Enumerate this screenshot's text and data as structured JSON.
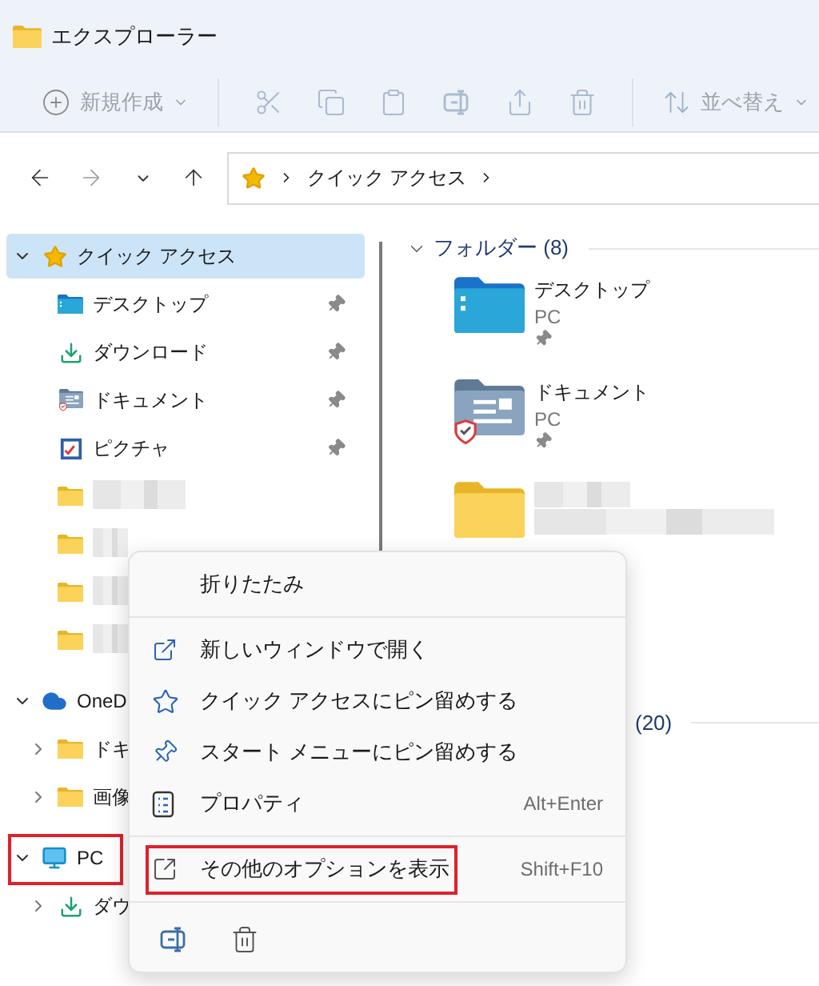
{
  "window": {
    "title": "エクスプローラー"
  },
  "toolbar": {
    "new_label": "新規作成",
    "sort_label": "並べ替え",
    "actions": [
      {
        "kind": "cut",
        "disabled": true
      },
      {
        "kind": "copy",
        "disabled": true
      },
      {
        "kind": "paste",
        "disabled": true
      },
      {
        "kind": "rename",
        "disabled": true
      },
      {
        "kind": "share",
        "disabled": true
      },
      {
        "kind": "delete",
        "disabled": true
      }
    ]
  },
  "navigation": {
    "back_disabled": false,
    "forward_disabled": true
  },
  "address_bar": {
    "path": [
      "クイック アクセス"
    ]
  },
  "sidebar": {
    "items": [
      {
        "label": "クイック アクセス",
        "kind": "star",
        "expanded": true,
        "selected": true,
        "children": [
          {
            "label": "デスクトップ",
            "kind": "desktop",
            "pinned": true,
            "selected": false
          },
          {
            "label": "ダウンロード",
            "kind": "download",
            "pinned": true,
            "selected": false
          },
          {
            "label": "ドキュメント",
            "kind": "documents",
            "pinned": true,
            "selected": false
          },
          {
            "label": "ピクチャ",
            "kind": "pictures",
            "pinned": true,
            "selected": false
          },
          {
            "kind": "folder",
            "blurred": true,
            "pinned": false,
            "selected": false
          },
          {
            "kind": "folder",
            "blurred": true,
            "pinned": false,
            "selected": false
          },
          {
            "kind": "folder",
            "blurred": true,
            "pinned": false,
            "selected": false
          },
          {
            "kind": "folder",
            "blurred": true,
            "pinned": false,
            "selected": false
          }
        ]
      },
      {
        "label": "OneD",
        "kind": "cloud",
        "expanded": true,
        "selected": false,
        "children": [
          {
            "label": "ドキ",
            "kind": "folder",
            "expanded": false,
            "selected": false
          },
          {
            "label": "画像",
            "kind": "folder",
            "expanded": false,
            "selected": false
          }
        ]
      },
      {
        "label": "PC",
        "kind": "pc",
        "expanded": true,
        "selected": false,
        "annotated": true,
        "children": [
          {
            "label": "ダウ",
            "kind": "download",
            "expanded": false,
            "selected": false
          }
        ]
      }
    ]
  },
  "main": {
    "sections": [
      {
        "title": "フォルダー (8)",
        "expanded": true,
        "items": [
          {
            "name": "デスクトップ",
            "location": "PC",
            "pinned": true,
            "kind": "desktop"
          },
          {
            "name": "ドキュメント",
            "location": "PC",
            "pinned": true,
            "kind": "documents"
          },
          {
            "kind": "folder",
            "blurred": true
          }
        ]
      },
      {
        "title": "(20)"
      }
    ]
  },
  "context_menu": {
    "items": [
      {
        "kind": "item",
        "label": "折りたたみ"
      },
      {
        "kind": "separator"
      },
      {
        "kind": "item",
        "label": "新しいウィンドウで開く"
      },
      {
        "kind": "item",
        "label": "クイック アクセスにピン留めする"
      },
      {
        "kind": "item",
        "label": "スタート メニューにピン留めする"
      },
      {
        "kind": "item",
        "label": "プロパティ",
        "shortcut": "Alt+Enter"
      },
      {
        "kind": "separator"
      },
      {
        "kind": "item",
        "label": "その他のオプションを表示",
        "shortcut": "Shift+F10",
        "annotated": true
      },
      {
        "kind": "separator"
      }
    ],
    "footer_actions": [
      {
        "kind": "rename"
      },
      {
        "kind": "delete"
      }
    ]
  }
}
